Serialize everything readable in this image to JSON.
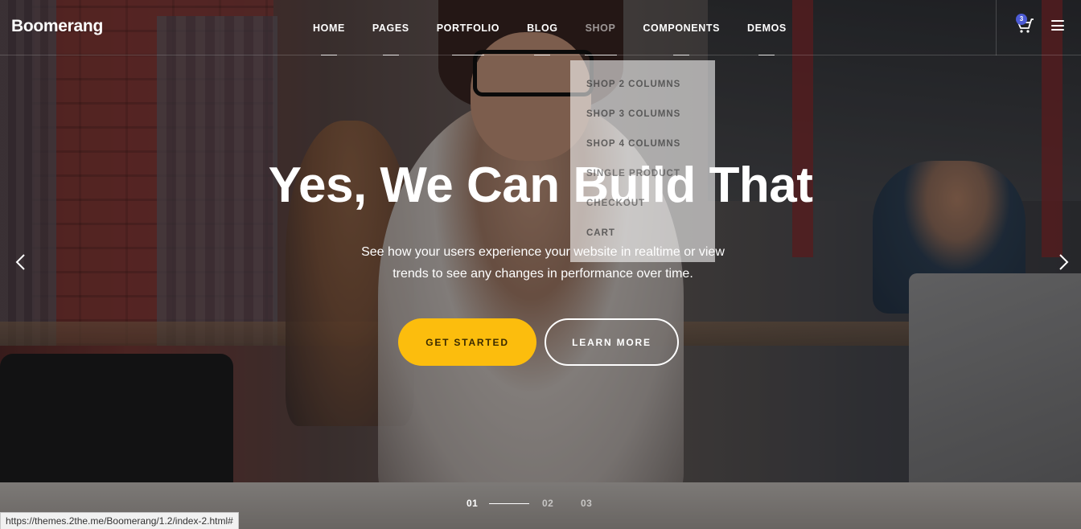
{
  "header": {
    "logo": "Boomerang",
    "nav": [
      {
        "label": "HOME"
      },
      {
        "label": "PAGES"
      },
      {
        "label": "PORTFOLIO"
      },
      {
        "label": "BLOG"
      },
      {
        "label": "SHOP"
      },
      {
        "label": "COMPONENTS"
      },
      {
        "label": "DEMOS"
      }
    ],
    "cart_count": "3"
  },
  "dropdown": {
    "items": [
      "SHOP 2 COLUMNS",
      "SHOP 3 COLUMNS",
      "SHOP 4 COLUMNS",
      "SINGLE PRODUCT",
      "CHECKOUT",
      "CART"
    ]
  },
  "hero": {
    "title": "Yes, We Can Build That",
    "subtitle_line1": "See how your users experience your website in realtime or view",
    "subtitle_line2": "trends to see any changes in performance over time.",
    "primary_button": "GET STARTED",
    "secondary_button": "LEARN MORE"
  },
  "pager": {
    "slides": [
      "01",
      "02",
      "03"
    ],
    "active": "01"
  },
  "statusbar": {
    "url": "https://themes.2the.me/Boomerang/1.2/index-2.html#"
  },
  "colors": {
    "primary_button": "#fcbd0d",
    "cart_badge": "#4c5bd4"
  }
}
